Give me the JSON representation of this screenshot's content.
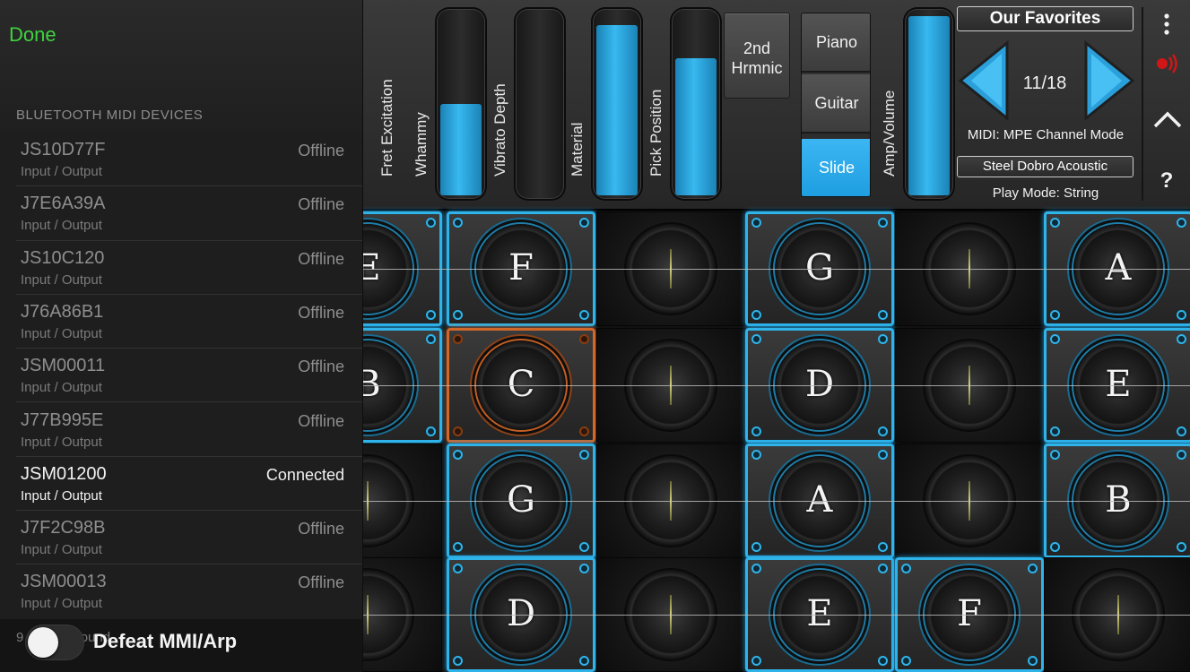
{
  "bluetooth_panel": {
    "done_label": "Done",
    "section_title": "BLUETOOTH MIDI DEVICES",
    "devices": [
      {
        "name": "JS10D77F",
        "status": "Offline",
        "io": "Input / Output"
      },
      {
        "name": "J7E6A39A",
        "status": "Offline",
        "io": "Input / Output"
      },
      {
        "name": "JS10C120",
        "status": "Offline",
        "io": "Input / Output"
      },
      {
        "name": "J76A86B1",
        "status": "Offline",
        "io": "Input / Output"
      },
      {
        "name": "JSM00011",
        "status": "Offline",
        "io": "Input / Output"
      },
      {
        "name": "J77B995E",
        "status": "Offline",
        "io": "Input / Output"
      },
      {
        "name": "JSM01200",
        "status": "Connected",
        "io": "Input / Output"
      },
      {
        "name": "J7F2C98B",
        "status": "Offline",
        "io": "Input / Output"
      },
      {
        "name": "JSM00013",
        "status": "Offline",
        "io": "Input / Output"
      }
    ],
    "device_count_text": "9 devices found"
  },
  "defeat_toggle": {
    "label": "Defeat MMI/Arp",
    "on": false
  },
  "sliders": [
    {
      "label": "Fret Excitation",
      "level": 0
    },
    {
      "label": "Whammy",
      "level": 0.5
    },
    {
      "label": "Vibrato Depth",
      "level": 0
    },
    {
      "label": "Material",
      "level": 0.93
    },
    {
      "label": "Pick Position",
      "level": 0.75
    },
    {
      "label": "Amp/Volume",
      "level": 0.98
    }
  ],
  "harmonic_button": {
    "line1": "2nd",
    "line2": "Hrmnic"
  },
  "mode_buttons": [
    {
      "label": "Piano",
      "active": false
    },
    {
      "label": "Guitar",
      "active": false
    },
    {
      "label": "Slide",
      "active": true
    }
  ],
  "favorites": {
    "title": "Our Favorites",
    "counter": "11/18",
    "midi_mode": "MIDI: MPE Channel Mode",
    "preset_name": "Steel Dobro Acoustic",
    "play_mode": "Play Mode: String"
  },
  "side_icons": [
    "more-vertical-icon",
    "bluetooth-signal-icon",
    "chevron-up-icon",
    "help-icon"
  ],
  "help_label": "?",
  "colors": {
    "accent_blue": "#2fb4ea",
    "active_orange": "#d2672a",
    "done_green": "#3fd33f"
  },
  "grid": {
    "rows": [
      [
        {
          "note": "E",
          "state": "on"
        },
        {
          "note": "F",
          "state": "on"
        },
        {
          "note": "",
          "state": "off"
        },
        {
          "note": "G",
          "state": "on"
        },
        {
          "note": "",
          "state": "off"
        },
        {
          "note": "A",
          "state": "on"
        }
      ],
      [
        {
          "note": "B",
          "state": "on"
        },
        {
          "note": "C",
          "state": "pressed"
        },
        {
          "note": "",
          "state": "off"
        },
        {
          "note": "D",
          "state": "on"
        },
        {
          "note": "",
          "state": "off"
        },
        {
          "note": "E",
          "state": "on"
        }
      ],
      [
        {
          "note": "",
          "state": "off"
        },
        {
          "note": "G",
          "state": "on"
        },
        {
          "note": "",
          "state": "off"
        },
        {
          "note": "A",
          "state": "on"
        },
        {
          "note": "",
          "state": "off"
        },
        {
          "note": "B",
          "state": "on"
        }
      ],
      [
        {
          "note": "",
          "state": "off"
        },
        {
          "note": "D",
          "state": "on"
        },
        {
          "note": "",
          "state": "off"
        },
        {
          "note": "E",
          "state": "on"
        },
        {
          "note": "F",
          "state": "on"
        },
        {
          "note": "",
          "state": "off"
        }
      ]
    ]
  }
}
